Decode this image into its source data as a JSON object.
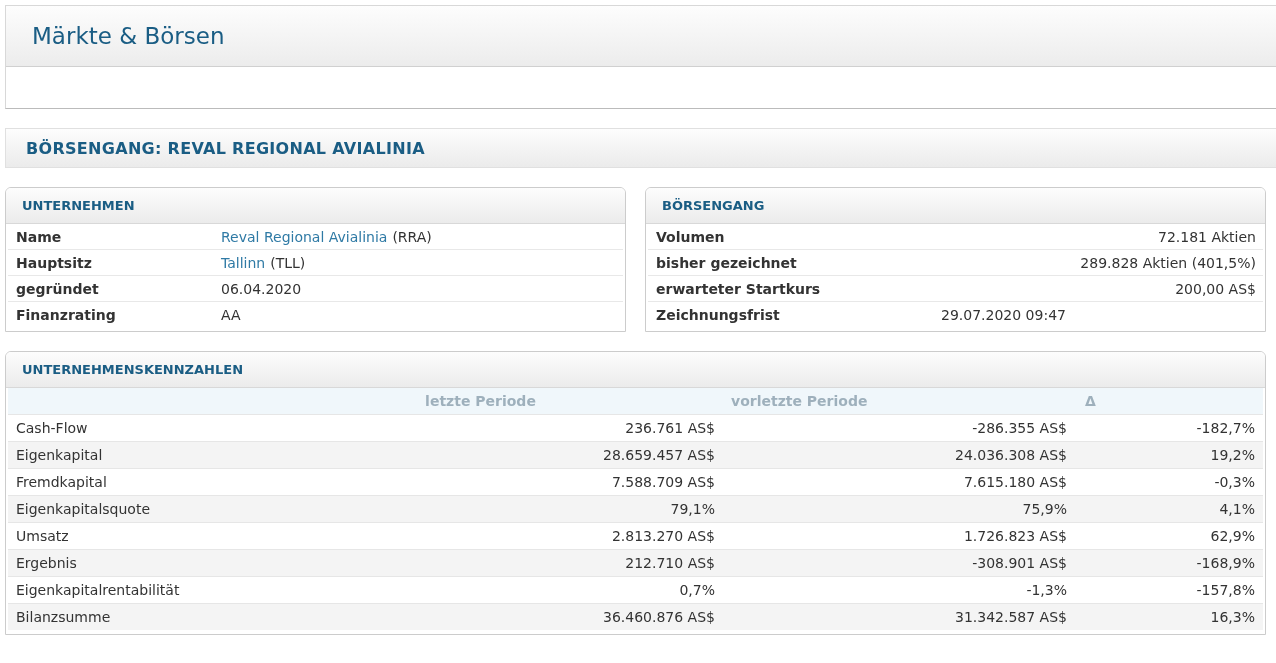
{
  "page_title": "Märkte & Börsen",
  "section_title": "BÖRSENGANG: REVAL REGIONAL AVIALINIA",
  "company": {
    "title": "UNTERNEHMEN",
    "rows": [
      {
        "label": "Name",
        "link": "Reval Regional Avialinia",
        "value": "(RRA)"
      },
      {
        "label": "Hauptsitz",
        "link": "Tallinn",
        "value": "(TLL)"
      },
      {
        "label": "gegründet",
        "value": "06.04.2020"
      },
      {
        "label": "Finanzrating",
        "value": "AA"
      }
    ]
  },
  "ipo": {
    "title": "BÖRSENGANG",
    "rows": [
      {
        "label": "Volumen",
        "value": "72.181 Aktien",
        "kind": "amount"
      },
      {
        "label": "bisher gezeichnet",
        "value": "289.828 Aktien (401,5%)",
        "kind": "amount"
      },
      {
        "label": "erwarteter Startkurs",
        "value": "200,00 AS$",
        "kind": "amount"
      },
      {
        "label": "Zeichnungsfrist",
        "value": "29.07.2020 09:47",
        "kind": "date"
      }
    ]
  },
  "figures": {
    "title": "UNTERNEHMENSKENNZAHLEN",
    "columns": [
      "letzte Periode",
      "vorletzte Periode",
      "Δ"
    ],
    "rows": [
      {
        "label": "Cash-Flow",
        "cells": [
          "236.761 AS$",
          "-286.355 AS$",
          "-182,7%"
        ]
      },
      {
        "label": "Eigenkapital",
        "cells": [
          "28.659.457 AS$",
          "24.036.308 AS$",
          "19,2%"
        ]
      },
      {
        "label": "Fremdkapital",
        "cells": [
          "7.588.709 AS$",
          "7.615.180 AS$",
          "-0,3%"
        ]
      },
      {
        "label": "Eigenkapitalsquote",
        "cells": [
          "79,1%",
          "75,9%",
          "4,1%"
        ]
      },
      {
        "label": "Umsatz",
        "cells": [
          "2.813.270 AS$",
          "1.726.823 AS$",
          "62,9%"
        ]
      },
      {
        "label": "Ergebnis",
        "cells": [
          "212.710 AS$",
          "-308.901 AS$",
          "-168,9%"
        ]
      },
      {
        "label": "Eigenkapitalrentabilität",
        "cells": [
          "0,7%",
          "-1,3%",
          "-157,8%"
        ]
      },
      {
        "label": "Bilanzsumme",
        "cells": [
          "36.460.876 AS$",
          "31.342.587 AS$",
          "16,3%"
        ]
      }
    ]
  }
}
